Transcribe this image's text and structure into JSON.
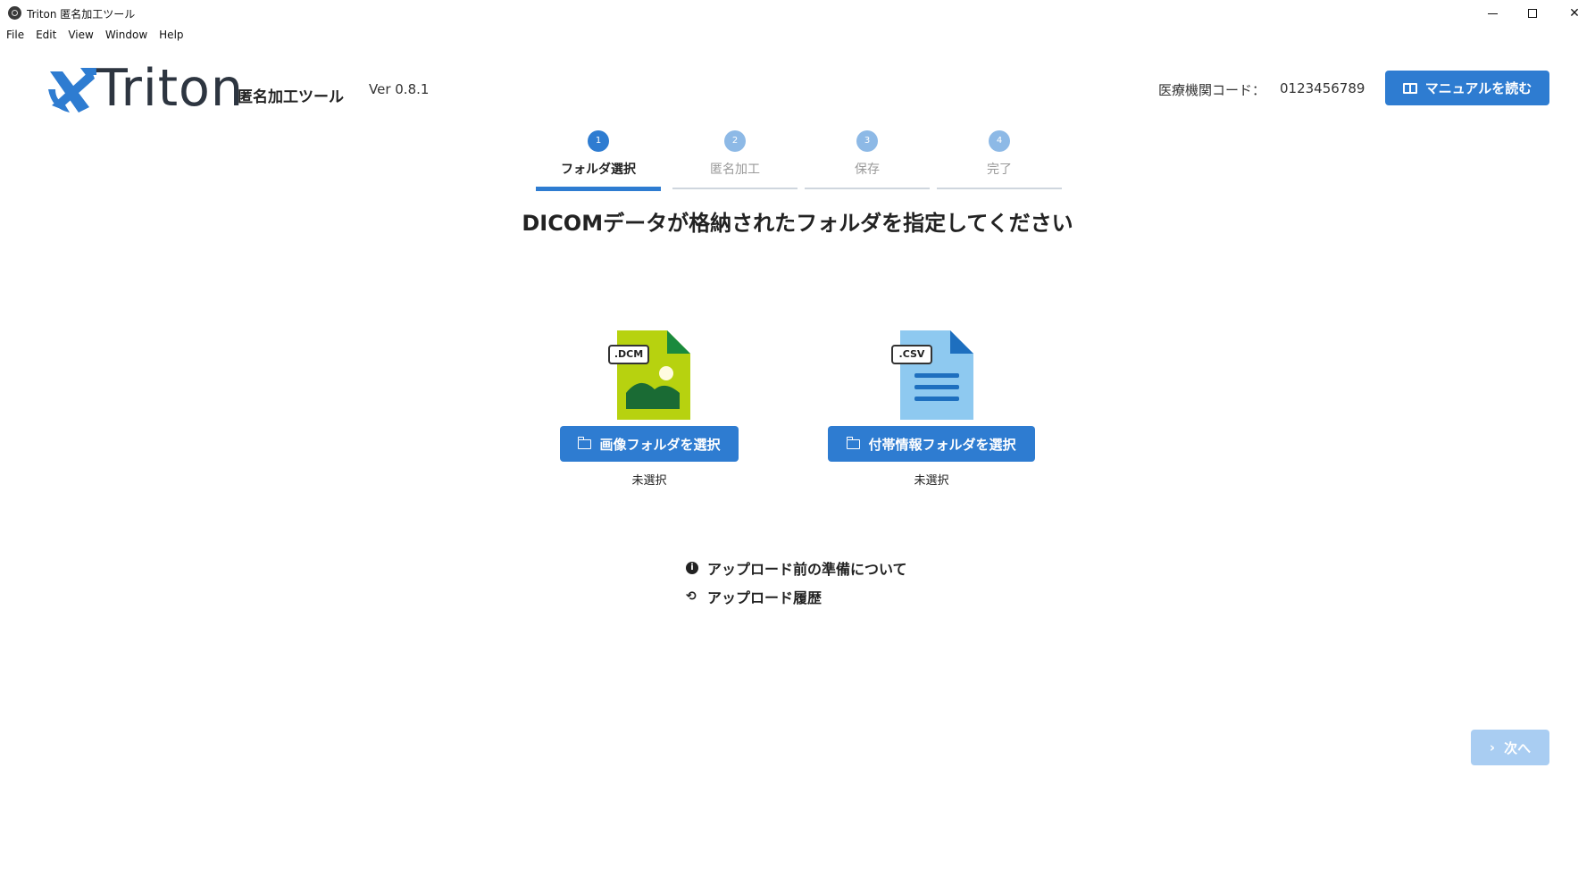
{
  "window": {
    "title": "Triton 匿名加工ツール",
    "minimize": "",
    "maximize": "",
    "close": "✕"
  },
  "menu": [
    "File",
    "Edit",
    "View",
    "Window",
    "Help"
  ],
  "header": {
    "logo_text": "Triton",
    "subtitle": "匿名加工ツール",
    "version": "Ver 0.8.1",
    "institution_code_label": "医療機関コード：",
    "institution_code_value": "0123456789",
    "manual_button": "マニュアルを読む"
  },
  "steps": [
    {
      "num": "1",
      "label": "フォルダ選択",
      "state": "active"
    },
    {
      "num": "2",
      "label": "匿名加工",
      "state": "inactive"
    },
    {
      "num": "3",
      "label": "保存",
      "state": "inactive"
    },
    {
      "num": "4",
      "label": "完了",
      "state": "inactive"
    }
  ],
  "main": {
    "heading": "DICOMデータが格納されたフォルダを指定してください",
    "image_folder": {
      "tag": ".DCM",
      "button": "画像フォルダを選択",
      "status": "未選択"
    },
    "info_folder": {
      "tag": ".CSV",
      "button": "付帯情報フォルダを選択",
      "status": "未選択"
    },
    "links": {
      "prep": "アップロード前の準備について",
      "history": "アップロード履歴"
    },
    "next_button": "次へ"
  },
  "colors": {
    "primary": "#2e7cd1",
    "primary_disabled": "#a9cdf2",
    "dcm_green": "#b7d20f",
    "dcm_dark": "#1a8a3d",
    "csv_light": "#8ec9f0",
    "csv_dark": "#1e6fbf"
  }
}
